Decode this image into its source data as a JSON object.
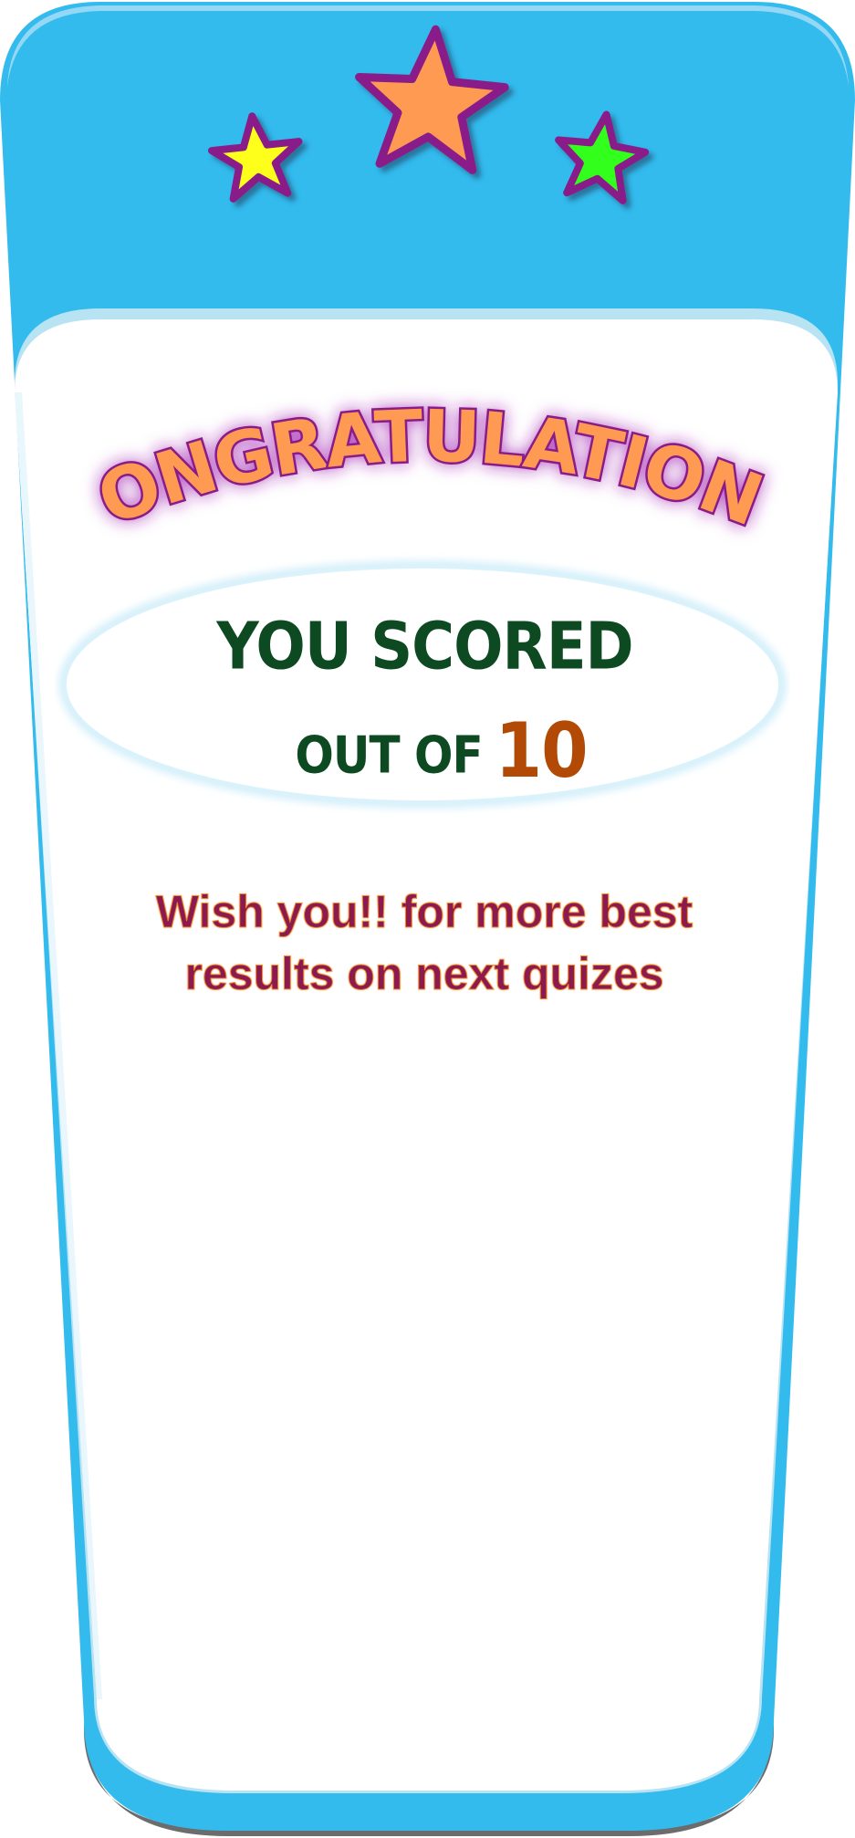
{
  "result": {
    "title": "CONGRATULATIONS",
    "score_line": "YOU SCORED",
    "out_of_label": "OUT OF",
    "total": "10",
    "message_line1": "Wish you!! for more best",
    "message_line2": "results on next quizes"
  },
  "stars": [
    {
      "name": "left",
      "color": "#ffff1a"
    },
    {
      "name": "center",
      "color": "#ff9a52"
    },
    {
      "name": "right",
      "color": "#33ff1a"
    }
  ],
  "colors": {
    "frame_blue": "#33bbee",
    "star_outline": "#8a1a8a",
    "title_fill": "#ff9a52",
    "title_glow": "#a01fb0",
    "score_green": "#0d4a22",
    "total_orange": "#b24a06",
    "message_maroon": "#8b1a4f"
  }
}
